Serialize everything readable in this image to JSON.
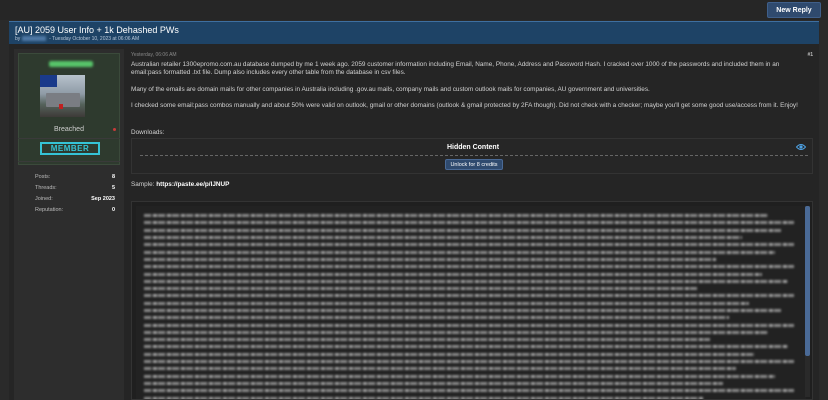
{
  "toolbar": {
    "new_reply_label": "New Reply"
  },
  "thread": {
    "title": "[AU] 2059 User Info + 1k Dehashed PWs",
    "meta_prefix": "by",
    "meta_date": "- Tuesday October 10, 2023 at 06:06 AM"
  },
  "author": {
    "rank_label": "Breached",
    "badge": "MEMBER",
    "stats": [
      {
        "label": "Posts:",
        "value": "8"
      },
      {
        "label": "Threads:",
        "value": "5"
      },
      {
        "label": "Joined:",
        "value": "Sep 2023"
      },
      {
        "label": "Reputation:",
        "value": "0"
      }
    ]
  },
  "post": {
    "timestamp": "Yesterday, 06:06 AM",
    "number": "#1",
    "paragraph_1": "Australian retailer 1300epromo.com.au database dumped by me 1 week ago. 2059 customer information including Email, Name, Phone, Address and Password Hash. I cracked over 1000 of the passwords and included them in an email:pass formatted .txt file. Dump also includes every other table from the database in csv files.",
    "paragraph_2": "Many of the emails are domain mails for other companies in Australia including .gov.au mails, company mails and custom outlook mails for companies, AU government and universities.",
    "paragraph_3": "I checked some email:pass combos manually and about 50% were valid on outlook, gmail or other domains (outlook & gmail protected by 2FA though). Did not check with a checker; maybe you'll get some good use/access from it. Enjoy!",
    "downloads_label": "Downloads:",
    "hidden_title": "Hidden Content",
    "unlock_label": "Unlock for 8 credits",
    "sample_label": "Sample:",
    "sample_link": "https://paste.ee/p/IJNUP"
  },
  "icons": {
    "visibility": "eye-icon"
  },
  "colors": {
    "accent": "#35c4d6",
    "header_bg": "#1e4366",
    "button_bg": "#2f4a6e",
    "link_icon": "#4ea3e6"
  }
}
